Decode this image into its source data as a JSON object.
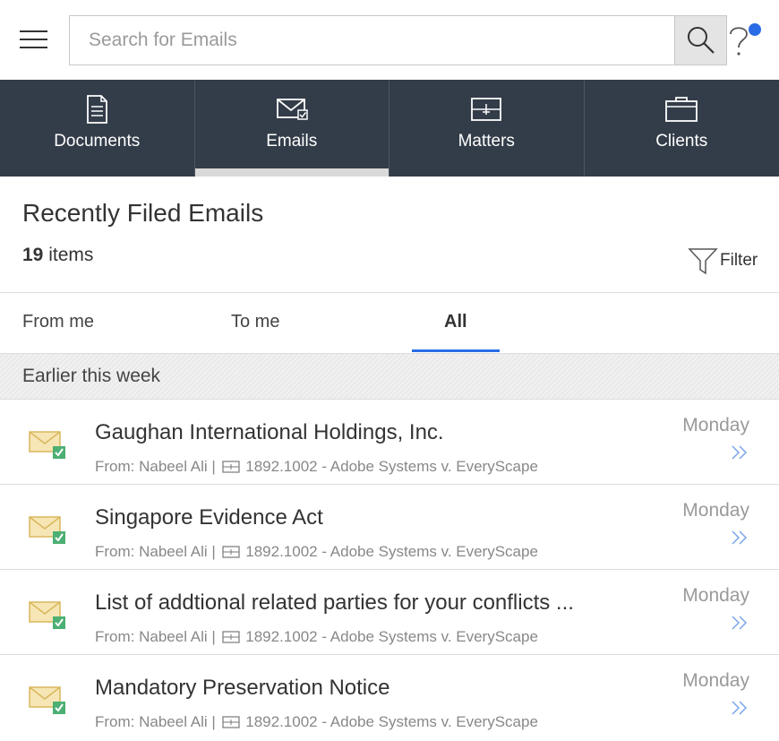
{
  "search": {
    "placeholder": "Search for Emails"
  },
  "nav": {
    "tabs": [
      {
        "label": "Documents",
        "icon": "document-icon",
        "active": false
      },
      {
        "label": "Emails",
        "icon": "email-icon",
        "active": true
      },
      {
        "label": "Matters",
        "icon": "matter-icon",
        "active": false
      },
      {
        "label": "Clients",
        "icon": "briefcase-icon",
        "active": false
      }
    ]
  },
  "main": {
    "title": "Recently Filed Emails",
    "count": "19",
    "count_label": "items",
    "filter_label": "Filter"
  },
  "subtabs": [
    {
      "label": "From me",
      "active": false
    },
    {
      "label": "To me",
      "active": false
    },
    {
      "label": "All",
      "active": true
    }
  ],
  "group": {
    "label": "Earlier this week"
  },
  "emails": [
    {
      "subject": "Gaughan International Holdings, Inc.",
      "from": "From: Nabeel Ali |",
      "matter": "1892.1002 - Adobe Systems v. EveryScape",
      "date": "Monday"
    },
    {
      "subject": "Singapore Evidence Act",
      "from": "From: Nabeel Ali |",
      "matter": "1892.1002 - Adobe Systems v. EveryScape",
      "date": "Monday"
    },
    {
      "subject": "List of addtional related parties for your conflicts ...",
      "from": "From: Nabeel Ali |",
      "matter": "1892.1002 - Adobe Systems v. EveryScape",
      "date": "Monday"
    },
    {
      "subject": "Mandatory Preservation Notice",
      "from": "From: Nabeel Ali |",
      "matter": "1892.1002 - Adobe Systems v. EveryScape",
      "date": "Monday"
    }
  ],
  "colors": {
    "nav_bg": "#333d49",
    "accent": "#2a6ce6",
    "envelope": "#e8c97a",
    "check": "#4caf73"
  }
}
